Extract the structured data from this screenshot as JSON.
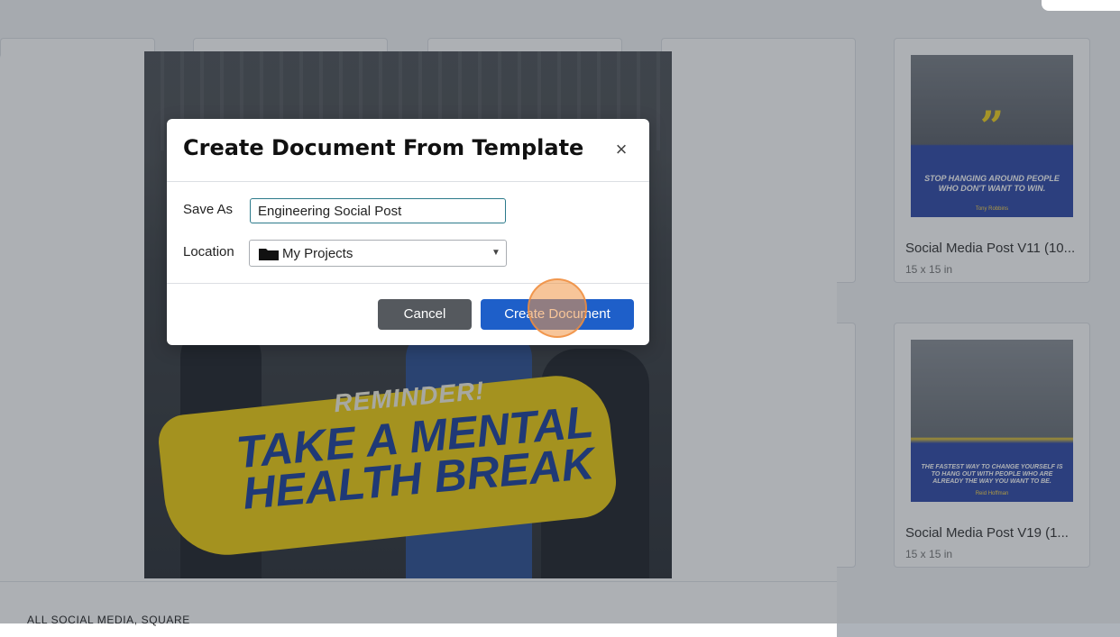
{
  "dialog": {
    "title": "Create Document From Template",
    "close_glyph": "×",
    "save_as_label": "Save As",
    "save_as_value": "Engineering Social Post",
    "location_label": "Location",
    "location_value": "My Projects",
    "cancel_label": "Cancel",
    "create_label": "Create Document"
  },
  "preview": {
    "reminder": "REMINDER!",
    "headline_line1": "TAKE A MENTAL",
    "headline_line2": "HEALTH BREAK",
    "category": "ALL SOCIAL MEDIA, SQUARE"
  },
  "cards": [
    {
      "title": "Social Media Post V11 (10...",
      "size": "15 x 15 in",
      "quote": "STOP HANGING AROUND PEOPLE WHO DON'T WANT TO WIN.",
      "author": "Tony Robbins"
    },
    {
      "title": "Social Media Post V19 (1...",
      "size": "15 x 15 in",
      "quote": "THE FASTEST WAY TO CHANGE YOURSELF IS TO HANG OUT WITH PEOPLE WHO ARE ALREADY THE WAY YOU WANT TO BE.",
      "author": "Reid Hoffman"
    }
  ],
  "colors": {
    "primary_button": "#1e5fc9",
    "cancel_button": "#55595e",
    "brush_yellow": "#f1cf0f",
    "headline_blue": "#1b3f9b"
  }
}
